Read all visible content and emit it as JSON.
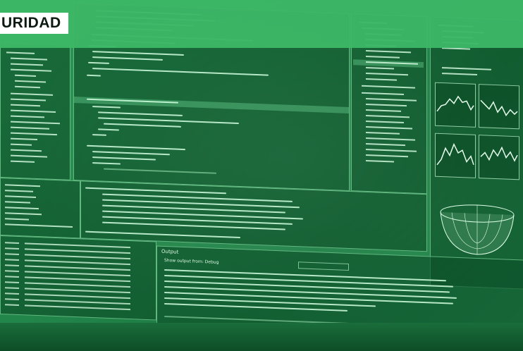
{
  "header": {
    "title": "URIDAD"
  },
  "output_panel": {
    "title": "Output",
    "show_output_from": "Show output from:  Debug"
  },
  "colors": {
    "tint": "#2e9a58",
    "header_band": "#3cb766",
    "title_bg": "#ffffff",
    "title_text": "#0d1a12"
  }
}
